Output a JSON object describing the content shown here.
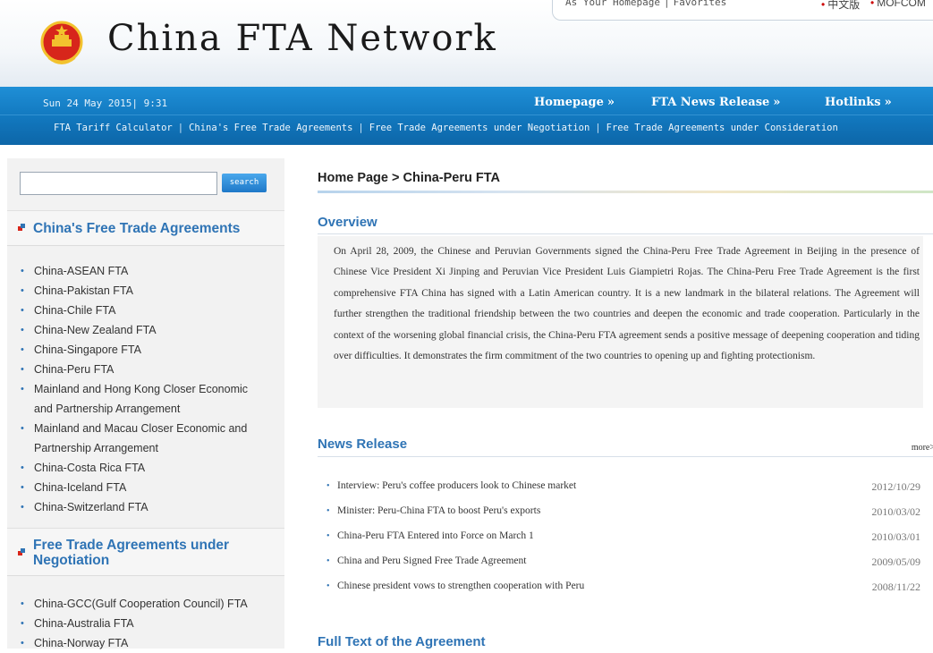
{
  "header": {
    "site_title": "China  FTA  Network",
    "homepage_link": "As Your Homepage",
    "favorites_link": "Favorites",
    "lang_chinese": "中文版",
    "lang_mofcom": "MOFCOM"
  },
  "topbar": {
    "datetime": "Sun 24 May 2015| 9:31",
    "nav": [
      {
        "label": "Homepage"
      },
      {
        "label": "FTA News Release"
      },
      {
        "label": "Hotlinks"
      }
    ],
    "arrow_glyph": "»",
    "subnav": [
      "FTA Tariff Calculator",
      "China's Free Trade Agreements",
      "Free Trade Agreements under Negotiation",
      "Free Trade Agreements under Consideration"
    ]
  },
  "sidebar": {
    "search_placeholder": "",
    "search_button": "search",
    "sections": [
      {
        "title": "China's Free Trade Agreements",
        "items": [
          "China-ASEAN FTA",
          "China-Pakistan FTA",
          "China-Chile FTA",
          "China-New Zealand FTA",
          "China-Singapore FTA",
          "China-Peru FTA",
          "Mainland and Hong Kong Closer Economic and Partnership Arrangement",
          "Mainland and Macau Closer Economic and Partnership Arrangement",
          "China-Costa Rica FTA",
          "China-Iceland FTA",
          "China-Switzerland FTA"
        ]
      },
      {
        "title": "Free Trade Agreements under Negotiation",
        "items": [
          "China-GCC(Gulf Cooperation Council) FTA",
          "China-Australia FTA",
          "China-Norway FTA"
        ]
      }
    ]
  },
  "main": {
    "breadcrumb": "Home Page > China-Peru FTA",
    "overview_title": "Overview",
    "overview_text": "On April 28, 2009, the Chinese and Peruvian Governments signed the China-Peru Free Trade Agreement in Beijing in the presence of Chinese Vice President Xi Jinping and Peruvian Vice President Luis Giampietri Rojas. The China-Peru Free Trade Agreement is the first comprehensive FTA China has signed with a Latin American country. It is a new landmark in the bilateral relations. The Agreement will further strengthen the traditional friendship between the two countries and deepen the economic and trade cooperation. Particularly in the context of the worsening global financial crisis, the China-Peru FTA agreement sends a positive message of deepening cooperation and tiding over difficulties. It demonstrates the firm commitment of the two countries to opening up and fighting protectionism.",
    "news_title": "News Release",
    "more_label": "more>",
    "news": [
      {
        "title": "Interview: Peru's coffee producers look to Chinese market",
        "date": "2012/10/29"
      },
      {
        "title": "Minister: Peru-China FTA to boost Peru's exports",
        "date": "2010/03/02"
      },
      {
        "title": "China-Peru FTA Entered into Force on March 1",
        "date": "2010/03/01"
      },
      {
        "title": "China and Peru Signed Free Trade Agreement",
        "date": "2009/05/09"
      },
      {
        "title": "Chinese president vows to strengthen cooperation with Peru",
        "date": "2008/11/22"
      }
    ],
    "fulltext_title": "Full Text of the Agreement"
  },
  "colors": {
    "accent_blue": "#2f74b5",
    "bar_blue": "#1279c0",
    "emblem_red": "#d7261b",
    "emblem_gold": "#f2c22e"
  }
}
